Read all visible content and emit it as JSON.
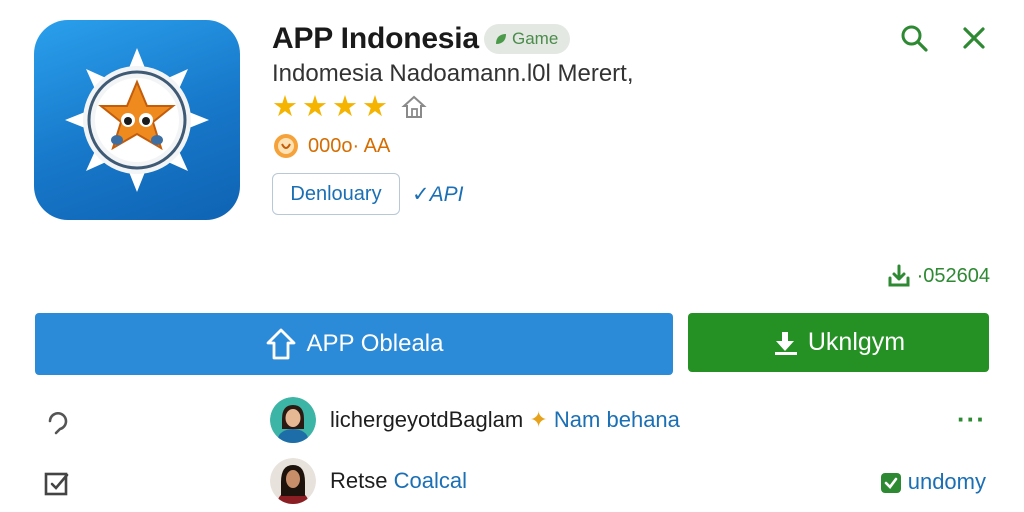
{
  "app": {
    "title": "APP Indonesia",
    "category_badge": "Game",
    "subtitle": "Indomesia Nadoamann.l0l Merert,",
    "rating": 4,
    "age_text": "000o· AA",
    "tag_label": "Denlouary",
    "tag_link": "✓API"
  },
  "header_actions": {
    "search_icon": "search-icon",
    "close_icon": "close-icon"
  },
  "downloads": {
    "count": "·052604"
  },
  "buttons": {
    "primary_label": "APP Obleala",
    "secondary_label": "Uknlgym"
  },
  "rows": [
    {
      "left_icon": "reply-icon",
      "name": "lichergeyotdBaglam",
      "link": "Nam behana",
      "right": "···"
    },
    {
      "left_icon": "edit-square-icon",
      "name": "Retse",
      "link": "Coalcal",
      "right": "undomy"
    }
  ],
  "colors": {
    "accent_blue": "#2b8bd8",
    "accent_green": "#259124",
    "star": "#f5b400",
    "link": "#1a6fb5"
  }
}
